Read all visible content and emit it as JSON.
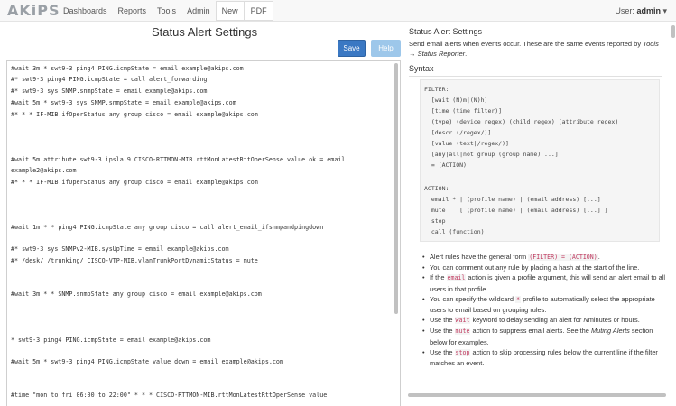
{
  "nav": {
    "logo": "AKiPS",
    "items": [
      "Dashboards",
      "Reports",
      "Tools",
      "Admin"
    ],
    "buttons": [
      "New",
      "PDF"
    ],
    "user_label": "User:",
    "user_name": "admin",
    "user_caret": "▾"
  },
  "left": {
    "title": "Status Alert Settings",
    "save_label": "Save",
    "help_label": "Help",
    "lines": [
      "#wait 3m * swt9-3 ping4 PING.icmpState = email example@akips.com",
      "#* swt9-3 ping4 PING.icmpState = call alert_forwarding",
      "#* swt9-3 sys SNMP.snmpState = email example@akips.com",
      "#wait 5m * swt9-3 sys SNMP.snmpState = email  example@akips.com",
      "#* * * IF-MIB.ifOperStatus any group cisco  = email example@akips.com",
      "#wait 5m attribute swt9-3 ipsla.9 CISCO-RTTMON-MIB.rttMonLatestRttOperSense value ok = email",
      "example2@akips.com",
      "#* * * IF-MIB.ifOperStatus any group cisco = email example@akips.com",
      "#wait 1m * * ping4 PING.icmpState any group cisco = call alert_email_ifsnmpandpingdown",
      "#* swt9-3 sys SNMPv2-MIB.sysUpTime = email example@akips.com",
      "#* /desk/ /trunking/ CISCO-VTP-MIB.vlanTrunkPortDynamicStatus = mute",
      "#wait 3m * * SNMP.snmpState any group cisco = email example@akips.com",
      "* swt9-3 ping4 PING.icmpState = email example@akips.com",
      "#wait 5m * swt9-3 ping4 PING.icmpState value down = email example@akips.com",
      "#time \"mon to fri 06:00 to 22:00\" * * * CISCO-RTTMON-MIB.rttMonLatestRttOperSense value"
    ]
  },
  "right": {
    "title": "Status Alert Settings",
    "desc_1": "Send email alerts when events occur. These are the same events reported by",
    "desc_tools": "Tools",
    "desc_arrow": "→",
    "desc_reporter": "Status Reporter",
    "desc_end": ".",
    "syntax_title": "Syntax",
    "code": [
      "FILTER:",
      "  [wait (N)m|(N)h]",
      "  [time (time filter)]",
      "  (type) (device regex) (child regex) (attribute regex)",
      "  [descr (/regex/)]",
      "  [value (text|/regex/)]",
      "  [any|all|not group (group name) ...]",
      "  = (ACTION)",
      "",
      "ACTION:",
      "  email * | (profile name) | (email address) [...]",
      "  mute    [ (profile name) | (email address) [...] ]",
      "  stop",
      "  call (function)"
    ],
    "b1_text": "Alert rules have the general form",
    "b1_code": "(FILTER) = (ACTION)",
    "b1_end": ".",
    "b2": "You can comment out any rule by placing a hash at the start of the line.",
    "b3_a": "If the",
    "b3_code": "email",
    "b3_b": "action is given a profile argument, this will send an alert email to all users in that profile.",
    "b4_a": "You can specify the wildcard",
    "b4_code": "*",
    "b4_b": "profile to automatically select the appropriate users to email based on grouping rules.",
    "b5_a": "Use the",
    "b5_code": "wait",
    "b5_b": "keyword to delay sending an alert for",
    "b5_n": "N",
    "b5_c": "minutes or hours.",
    "b6_a": "Use the",
    "b6_code": "mute",
    "b6_b": "action to suppress email alerts. See the",
    "b6_i": "Muting Alerts",
    "b6_c": "section below for examples.",
    "b7_a": "Use the",
    "b7_code": "stop",
    "b7_b": "action to skip processing rules below the current line if the filter matches an event."
  }
}
